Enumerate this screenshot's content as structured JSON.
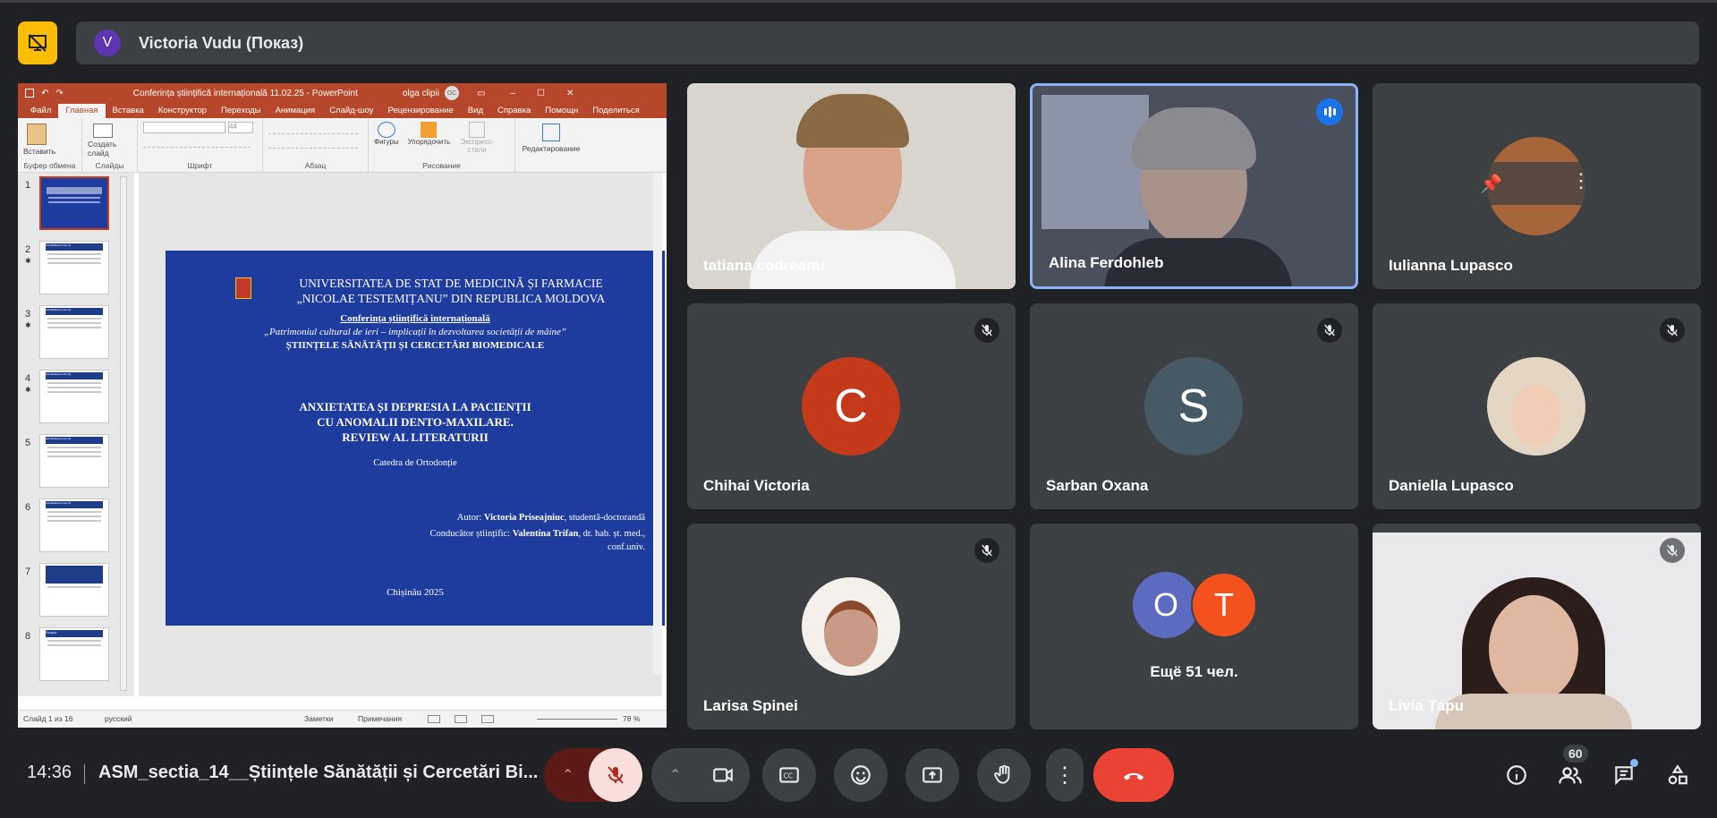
{
  "presenter": {
    "initial": "V",
    "label": "Victoria Vudu (Показ)"
  },
  "ppt": {
    "doc_title": "Conferința științifică internațională 11.02.25 - PowerPoint",
    "user": "olga clipii",
    "user_initials": "OC",
    "tabs": [
      "Файл",
      "Главная",
      "Вставка",
      "Конструктор",
      "Переходы",
      "Анимация",
      "Слайд-шоу",
      "Рецензирование",
      "Вид",
      "Справка",
      "Помощн",
      "Поделиться"
    ],
    "groups": {
      "clipboard": "Буфер обмена",
      "slides": "Слайды",
      "font": "Шрифт",
      "paragraph": "Абзац",
      "drawing": "Рисование",
      "edit": "Редактирование"
    },
    "buttons": {
      "paste": "Вставить",
      "new_slide": "Создать слайд",
      "shapes": "Фигуры",
      "arrange": "Упорядочить",
      "styles": "Экспресс-стили",
      "edit": "Редактирование"
    },
    "font_size": "44",
    "thumbs": [
      {
        "n": "1",
        "star": ""
      },
      {
        "n": "2",
        "star": "✱"
      },
      {
        "n": "3",
        "star": "✱"
      },
      {
        "n": "4",
        "star": "✱"
      },
      {
        "n": "5",
        "star": ""
      },
      {
        "n": "6",
        "star": ""
      },
      {
        "n": "7",
        "star": ""
      },
      {
        "n": "8",
        "star": ""
      }
    ],
    "thumb_titles": [
      "",
      "Actualitatea temei (1)",
      "Actualitatea temei (2)",
      "Actualitatea temei (3)",
      "Actualitatea temei (4)",
      "Actualitatea temei (5)",
      "",
      "Scopul"
    ],
    "slide": {
      "univ1": "UNIVERSITATEA DE STAT DE MEDICINĂ ȘI FARMACIE",
      "univ2": "„NICOLAE TESTEMIȚANU” DIN REPUBLICA MOLDOVA",
      "conf": "Conferința științifică internațională",
      "theme": "„Patrimoniul cultural de ieri – implicații în dezvoltarea societății de mâine”",
      "section": "ȘTIINȚELE SĂNĂTĂȚII ȘI CERCETĂRI BIOMEDICALE",
      "t1": "ANXIETATEA ȘI DEPRESIA LA PACIENȚII",
      "t2": "CU ANOMALII DENTO-MAXILARE.",
      "t3": "REVIEW AL LITERATURII",
      "dept": "Catedra de Ortodonție",
      "author_label": "Autor:",
      "author": "Victoria Priseajniuc",
      "author_role": ", studentă-doctorandă",
      "sup_label": "Conducător științific:",
      "sup": "Valentina Trifan",
      "sup_role": ", dr. hab. șt. med.,",
      "sup_role2": "conf.univ.",
      "city": "Chișinău 2025"
    },
    "status": {
      "slide": "Слайд 1 из 16",
      "lang": "русский",
      "notes": "Заметки",
      "comments": "Примечания",
      "zoom": "78 %"
    }
  },
  "participants": [
    {
      "name": "tatiana codreanu"
    },
    {
      "name": "Alina Ferdohleb"
    },
    {
      "name": "Iulianna Lupasco"
    },
    {
      "name": "Chihai Victoria",
      "initial": "C",
      "color": "#c5391b"
    },
    {
      "name": "Sarban Oxana",
      "initial": "S",
      "color": "#455a64"
    },
    {
      "name": "Daniella Lupasco"
    },
    {
      "name": "Larisa Spinei"
    },
    {
      "others": "Ещё 51 чел.",
      "i1": "O",
      "c1": "#5c6bc0",
      "i2": "T",
      "c2": "#f4511e"
    },
    {
      "name": "Livia Țapu"
    }
  ],
  "bottom": {
    "time": "14:36",
    "meeting": "ASM_sectia_14__Științele Sănătății și Cercetări Bi...",
    "people_count": "60"
  }
}
